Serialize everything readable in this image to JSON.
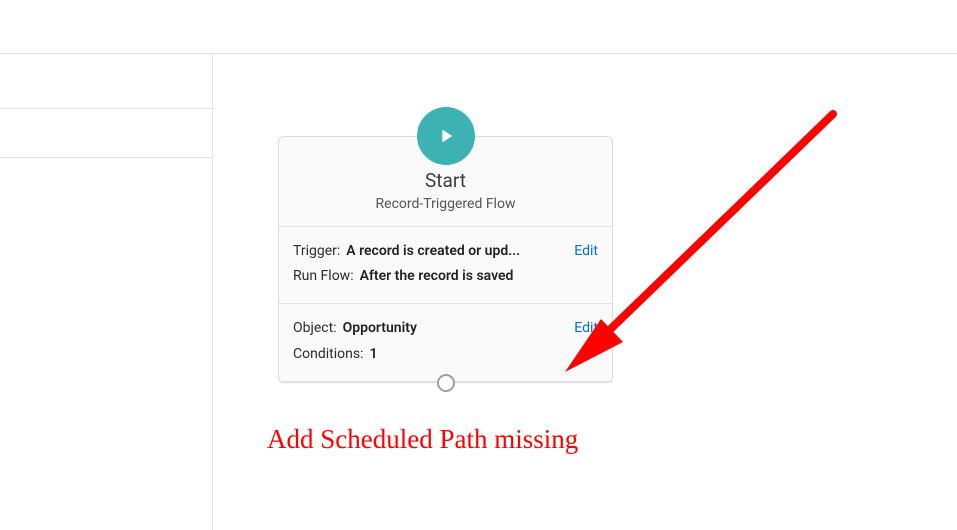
{
  "start_card": {
    "title": "Start",
    "subtitle": "Record-Triggered Flow",
    "trigger_section": {
      "trigger_label": "Trigger:",
      "trigger_value": "A record is created or upd...",
      "runflow_label": "Run Flow:",
      "runflow_value": "After the record is saved",
      "edit_label": "Edit"
    },
    "object_section": {
      "object_label": "Object:",
      "object_value": "Opportunity",
      "conditions_label": "Conditions:",
      "conditions_value": "1",
      "edit_label": "Edit"
    }
  },
  "annotation": {
    "text": "Add Scheduled Path missing",
    "color": "#ff0000"
  }
}
